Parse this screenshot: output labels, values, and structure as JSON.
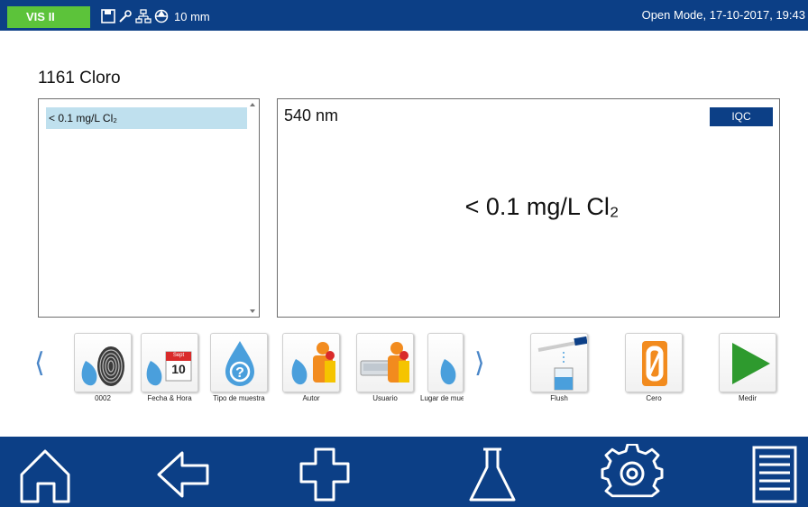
{
  "status_bar": {
    "mode_badge": "VIS II",
    "cell_length": "10 mm",
    "mode_datetime": "Open Mode, 17-10-2017, 19:43",
    "icons": [
      "save-icon",
      "wrench-icon",
      "network-icon",
      "lamp-icon"
    ]
  },
  "page": {
    "title": "1161 Cloro"
  },
  "results": {
    "list": [
      {
        "text": "< 0.1 mg/L Cl₂"
      }
    ],
    "wavelength": "540 nm",
    "iqc_label": "IQC",
    "value": "< 0.1 mg/L Cl₂"
  },
  "toolbar": {
    "prev_arrow": "⟨",
    "next_arrow": "⟩",
    "calendar_month": "Sept",
    "calendar_day": "10",
    "tiles": [
      {
        "label": "0002",
        "icon": "fingerprint-icon"
      },
      {
        "label": "Fecha & Hora",
        "icon": "calendar-icon"
      },
      {
        "label": "Tipo de muestra",
        "icon": "sample-type-icon"
      },
      {
        "label": "Autor",
        "icon": "author-icon"
      },
      {
        "label": "Usuario",
        "icon": "user-icon"
      },
      {
        "label": "Lugar de muestra",
        "icon": "sample-location-icon"
      },
      {
        "label": "Flush",
        "icon": "flush-icon"
      },
      {
        "label": "Cero",
        "icon": "zero-icon"
      },
      {
        "label": "Medir",
        "icon": "play-icon"
      }
    ]
  },
  "bottom_nav": [
    "home-icon",
    "back-icon",
    "plus-icon",
    "flask-icon",
    "gear-icon",
    "menu-icon"
  ],
  "colors": {
    "nav_blue": "#0c3f86",
    "badge_green": "#5cc33a",
    "selection": "#bfe0ee",
    "drop_blue": "#4a9fdc",
    "orange": "#f28b1e"
  }
}
